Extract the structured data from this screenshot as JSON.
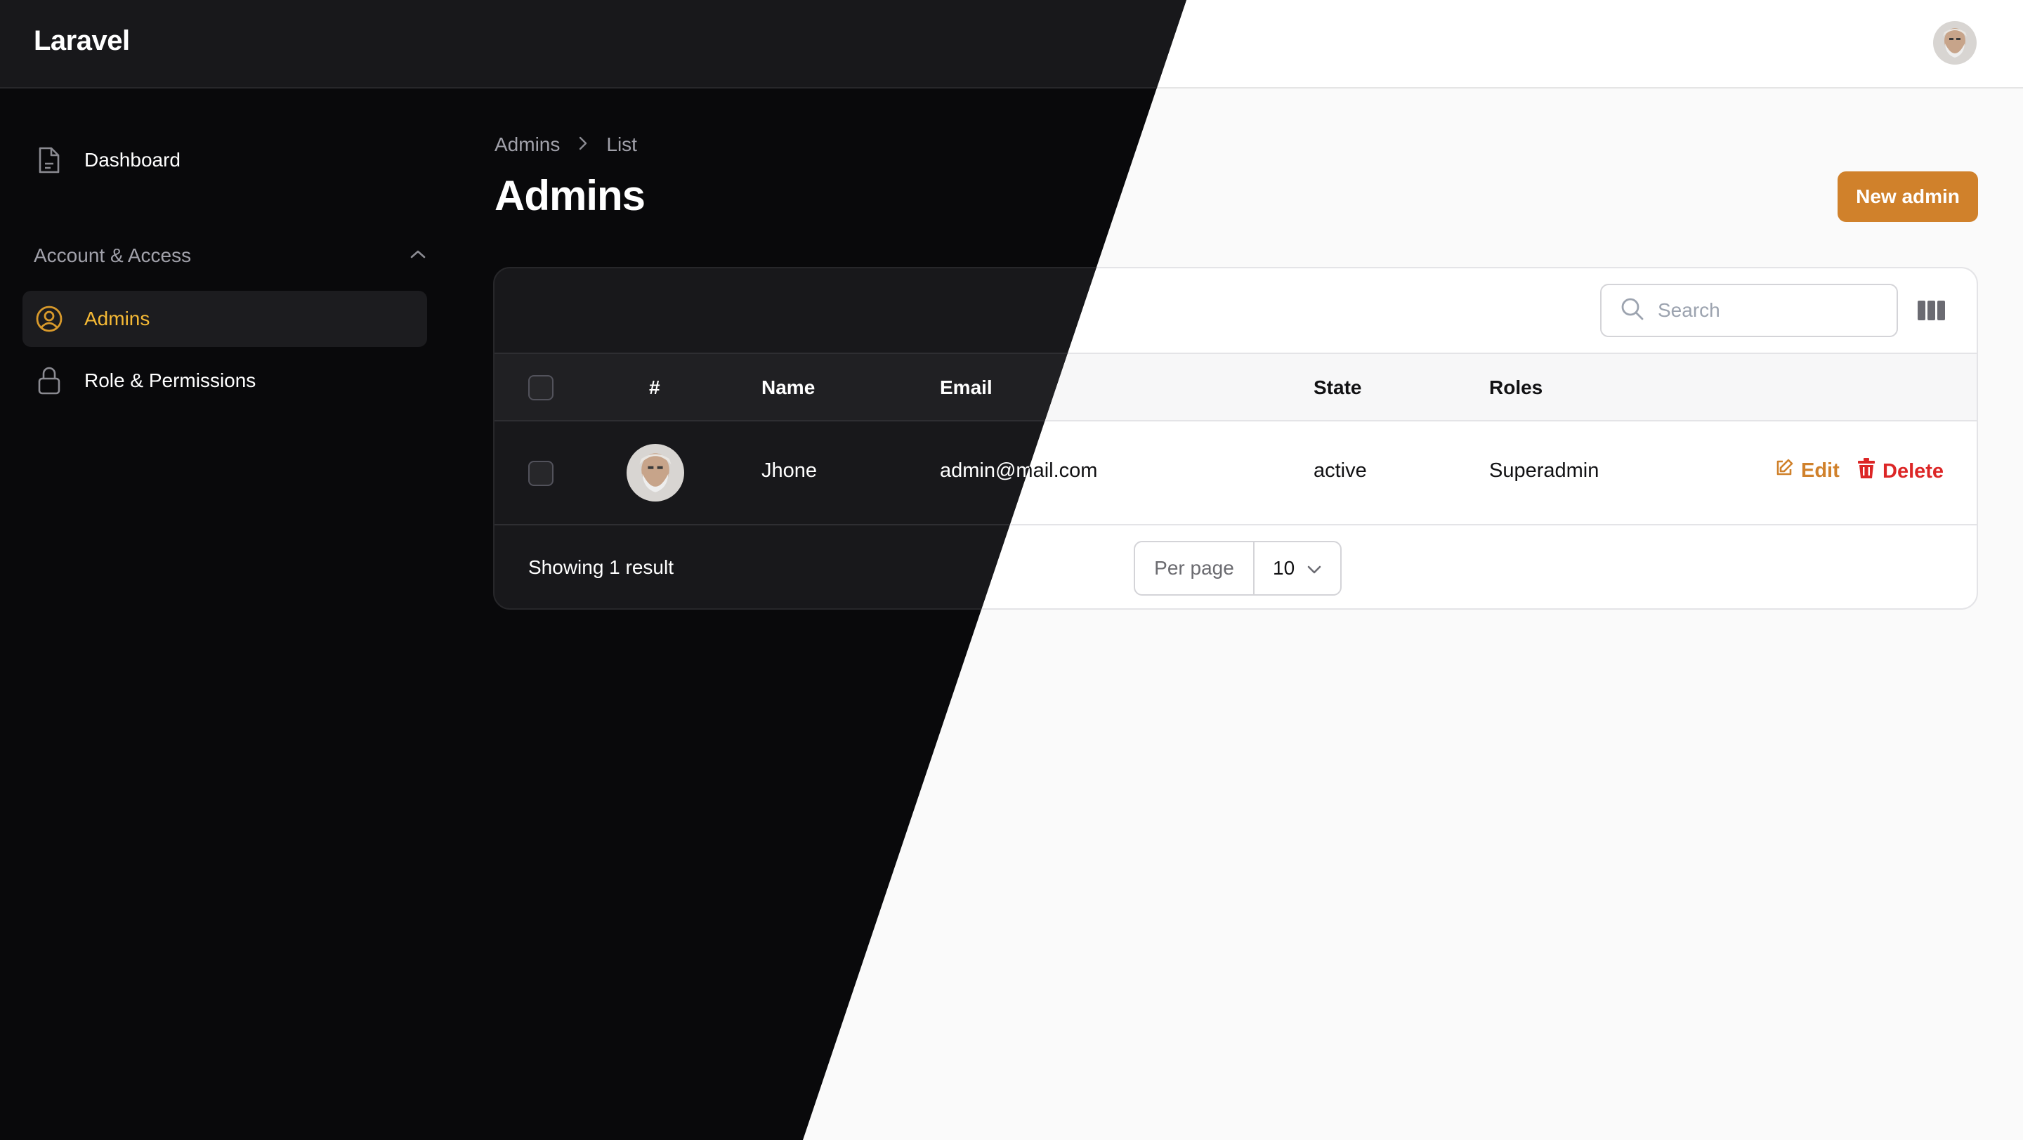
{
  "app": {
    "brand": "Laravel"
  },
  "sidebar": {
    "items": [
      {
        "label": "Dashboard",
        "icon": "document-icon"
      },
      {
        "label": "Admins",
        "icon": "user-circle-icon",
        "active": true
      },
      {
        "label": "Role & Permissions",
        "icon": "lock-icon"
      }
    ],
    "group": {
      "label": "Account & Access",
      "expanded": true
    }
  },
  "header": {
    "breadcrumb": [
      "Admins",
      "List"
    ],
    "title": "Admins",
    "new_button": "New admin"
  },
  "table": {
    "search_placeholder": "Search",
    "columns": [
      "#",
      "Name",
      "Email",
      "State",
      "Roles"
    ],
    "rows": [
      {
        "name": "Jhone",
        "email": "admin@mail.com",
        "state": "active",
        "roles": "Superadmin"
      }
    ],
    "actions": {
      "edit": "Edit",
      "delete": "Delete"
    },
    "footer": {
      "summary": "Showing 1 result",
      "per_page_label": "Per page",
      "per_page_value": "10"
    }
  },
  "colors": {
    "accent": "#d0812b",
    "active_nav_dark": "#f5b935",
    "danger": "#dc2626"
  }
}
